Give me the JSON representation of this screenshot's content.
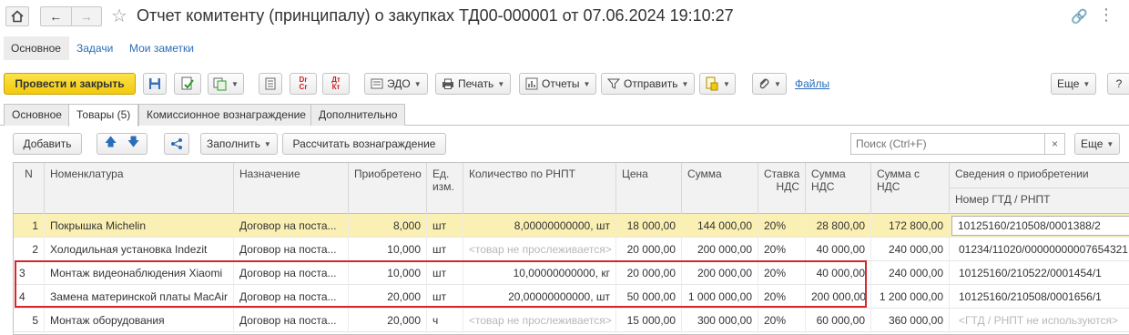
{
  "window": {
    "title": "Отчет комитенту (принципалу) о закупках ТД00-000001 от 07.06.2024 19:10:27"
  },
  "form_nav": {
    "main": "Основное",
    "tasks": "Задачи",
    "notes": "Мои заметки"
  },
  "toolbar": {
    "post_close": "Провести и закрыть",
    "edo": "ЭДО",
    "print": "Печать",
    "reports": "Отчеты",
    "send": "Отправить",
    "files": "Файлы",
    "more": "Еще",
    "help": "?",
    "dt_kt": "Дт Кт",
    "dr_cr": "Dr Cr"
  },
  "tabs": [
    "Основное",
    "Товары (5)",
    "Комиссионное вознаграждение",
    "Дополнительно"
  ],
  "table_toolbar": {
    "add": "Добавить",
    "fill": "Заполнить",
    "calc": "Рассчитать вознаграждение",
    "search_placeholder": "Поиск (Ctrl+F)",
    "clear": "×",
    "more": "Еще"
  },
  "columns": {
    "n": "N",
    "item": "Номенклатура",
    "purpose": "Назначение",
    "purchased": "Приобретено",
    "unit": "Ед. изм.",
    "rnpt_qty": "Количество по РНПТ",
    "price": "Цена",
    "sum": "Сумма",
    "vat_rate": "Ставка НДС",
    "vat_sum": "Сумма НДС",
    "sum_with_vat": "Сумма с НДС",
    "acq_info": "Сведения о приобретении",
    "gtd": "Номер ГТД / РНПТ"
  },
  "rows": [
    {
      "n": "1",
      "item": "Покрышка Michelin",
      "purpose": "Договор на поста...",
      "purchased": "8,000",
      "unit": "шт",
      "rnpt_qty": "8,00000000000, шт",
      "price": "18 000,00",
      "sum": "144 000,00",
      "vat_rate": "20%",
      "vat_sum": "28 800,00",
      "sum_with_vat": "172 800,00",
      "gtd": "10125160/210508/0001388/2"
    },
    {
      "n": "2",
      "item": "Холодильная установка Indezit",
      "purpose": "Договор на поста...",
      "purchased": "10,000",
      "unit": "шт",
      "rnpt_qty": "<товар не прослеживается>",
      "price": "20 000,00",
      "sum": "200 000,00",
      "vat_rate": "20%",
      "vat_sum": "40 000,00",
      "sum_with_vat": "240 000,00",
      "gtd": "01234/11020/00000000007654321"
    },
    {
      "n": "3",
      "item": "Монтаж видеонаблюдения Xiaomi",
      "purpose": "Договор на поста...",
      "purchased": "10,000",
      "unit": "шт",
      "rnpt_qty": "10,00000000000, кг",
      "price": "20 000,00",
      "sum": "200 000,00",
      "vat_rate": "20%",
      "vat_sum": "40 000,00",
      "sum_with_vat": "240 000,00",
      "gtd": "10125160/210522/0001454/1"
    },
    {
      "n": "4",
      "item": "Замена материнской платы MacAir",
      "purpose": "Договор на поста...",
      "purchased": "20,000",
      "unit": "шт",
      "rnpt_qty": "20,00000000000, шт",
      "price": "50 000,00",
      "sum": "1 000 000,00",
      "vat_rate": "20%",
      "vat_sum": "200 000,00",
      "sum_with_vat": "1 200 000,00",
      "gtd": "10125160/210508/0001656/1"
    },
    {
      "n": "5",
      "item": "Монтаж оборудования",
      "purpose": "Договор на поста...",
      "purchased": "20,000",
      "unit": "ч",
      "rnpt_qty": "<товар не прослеживается>",
      "price": "15 000,00",
      "sum": "300 000,00",
      "vat_rate": "20%",
      "vat_sum": "60 000,00",
      "sum_with_vat": "360 000,00",
      "gtd": "<ГТД / РНПТ не используются>"
    }
  ],
  "colors": {
    "primary_button": "#f3c90c",
    "selected_row": "#fbf0b4",
    "highlight_border": "#d8262c",
    "link": "#2a6eb8"
  }
}
